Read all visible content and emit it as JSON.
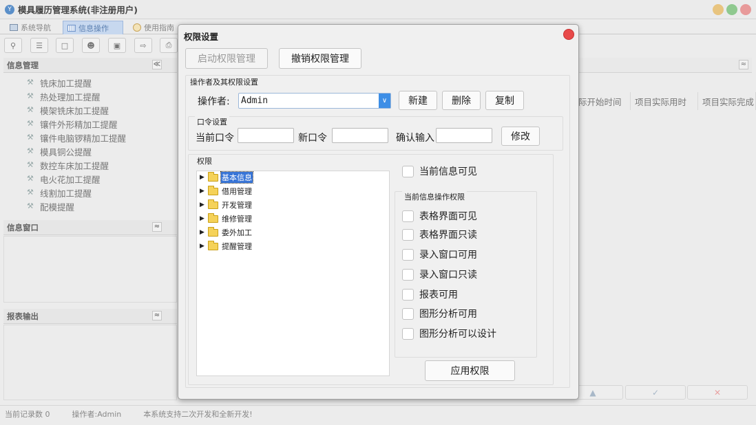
{
  "window": {
    "title": "模具履历管理系统(非注册用户)",
    "logo_glyph": "Y"
  },
  "tabs": [
    {
      "label": "系统导航"
    },
    {
      "label": "信息操作"
    },
    {
      "label": "使用指南"
    }
  ],
  "toolbar": {
    "buttons": [
      "search-tool",
      "list-tool",
      "document-tool",
      "user-tool",
      "window-tool",
      "export-tool",
      "print-tool"
    ]
  },
  "left_panel": {
    "info_management": {
      "title": "信息管理",
      "collapse_glyph": "≪",
      "items": [
        "铣床加工提醒",
        "热处理加工提醒",
        "模架铣床加工提醒",
        "镶件外形精加工提醒",
        "镶件电脑锣精加工提醒",
        "模具铜公提醒",
        "数控车床加工提醒",
        "电火花加工提醒",
        "线割加工提醒",
        "配模提醒"
      ]
    },
    "info_window": {
      "title": "信息窗口",
      "collapse_glyph": "≈"
    },
    "report_output": {
      "title": "报表输出",
      "collapse_glyph": "≈"
    }
  },
  "right_panel": {
    "collapse_glyph": "≈",
    "columns": [
      "际开始时间",
      "项目实际用时",
      "项目实际完成"
    ],
    "bottom_buttons": [
      "▲",
      "✓",
      "✕"
    ]
  },
  "status_bar": {
    "record_count": "当前记录数 0",
    "operator": "操作者:Admin",
    "message": "本系统支持二次开发和全新开发!"
  },
  "dialog": {
    "title": "权限设置",
    "enable_btn": "启动权限管理",
    "revoke_btn": "撤销权限管理",
    "operator_group_label": "操作者及其权限设置",
    "operator_label": "操作者:",
    "operator_value": "Admin",
    "new_btn": "新建",
    "delete_btn": "删除",
    "copy_btn": "复制",
    "password_group_label": "口令设置",
    "current_password_label": "当前口令",
    "new_password_label": "新口令",
    "confirm_label": "确认输入",
    "modify_btn": "修改",
    "permission_group_label": "权限",
    "tree": [
      {
        "label": "基本信息",
        "selected": true
      },
      {
        "label": "借用管理",
        "selected": false
      },
      {
        "label": "开发管理",
        "selected": false
      },
      {
        "label": "维修管理",
        "selected": false
      },
      {
        "label": "委外加工",
        "selected": false
      },
      {
        "label": "提醒管理",
        "selected": false
      }
    ],
    "visible_checkbox": "当前信息可见",
    "op_group_label": "当前信息操作权限",
    "checkboxes": [
      "表格界面可见",
      "表格界面只读",
      "录入窗口可用",
      "录入窗口只读",
      "报表可用",
      "图形分析可用",
      "图形分析可以设计"
    ],
    "apply_btn": "应用权限"
  }
}
